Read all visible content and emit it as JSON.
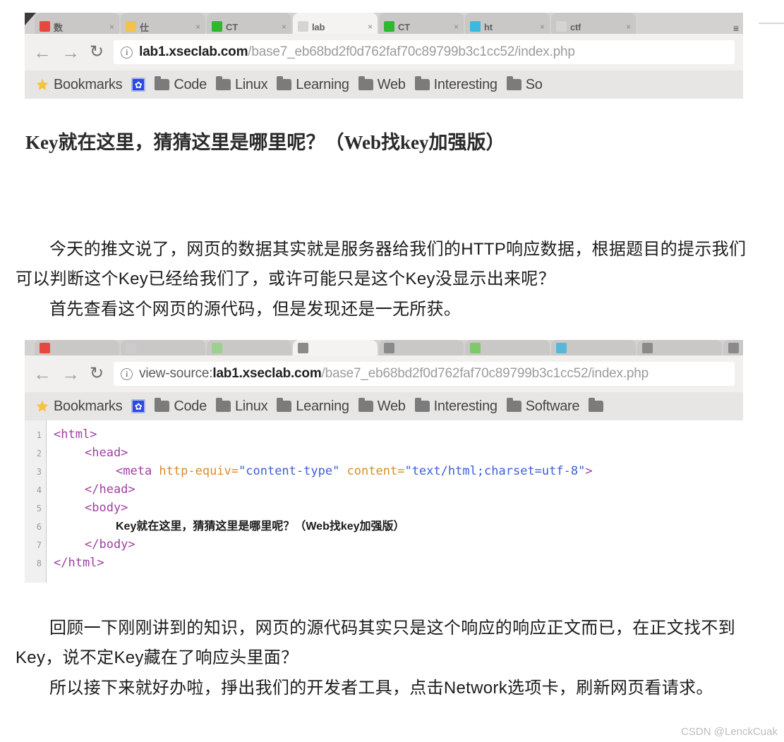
{
  "document": {
    "watermark": "CSDN @LenckCuak"
  },
  "frame": {
    "corner": "container-corner"
  },
  "shot1": {
    "tabs": [
      {
        "title": "数",
        "favicon_color": "#e8473f",
        "close": "×",
        "active": false
      },
      {
        "title": "仕",
        "favicon_color": "#f2c14e",
        "close": "×",
        "active": false
      },
      {
        "title": "CT",
        "favicon_color": "#2eb82e",
        "close": "×",
        "active": false
      },
      {
        "title": "lab",
        "favicon_color": "#d4d4d4",
        "close": "×",
        "active": true
      },
      {
        "title": "CT",
        "favicon_color": "#2eb82e",
        "close": "×",
        "active": false
      },
      {
        "title": "ht",
        "favicon_color": "#3bb9e0",
        "close": "×",
        "active": false
      },
      {
        "title": "ctf",
        "favicon_color": "#d4d4d4",
        "close": "×",
        "active": false
      }
    ],
    "tab_menu_icon": "menu-icon",
    "nav": {
      "back": "←",
      "forward": "→",
      "reload": "↻"
    },
    "omnibox": {
      "security_icon": "info-icon",
      "scheme": "",
      "host": "lab1.xseclab.com",
      "path": "/base7_eb68bd2f0d762faf70c89799b3c1cc52/index.php"
    },
    "bookmarks": [
      {
        "label": "Bookmarks",
        "icon": "star-icon"
      },
      {
        "label": "",
        "icon": "paw-icon"
      },
      {
        "label": "Code",
        "icon": "folder-icon"
      },
      {
        "label": "Linux",
        "icon": "folder-icon"
      },
      {
        "label": "Learning",
        "icon": "folder-icon"
      },
      {
        "label": "Web",
        "icon": "folder-icon"
      },
      {
        "label": "Interesting",
        "icon": "folder-icon"
      },
      {
        "label": "So",
        "icon": "folder-icon"
      }
    ]
  },
  "page_heading": "Key就在这里，猜猜这里是哪里呢？（Web找key加强版）",
  "paragraph1": "今天的推文说了，网页的数据其实就是服务器给我们的HTTP响应数据，根据题目的提示我们可以判断这个Key已经给我们了，或许可能只是这个Key没显示出来呢？",
  "paragraph2": "首先查看这个网页的源代码，但是发现还是一无所获。",
  "shot2": {
    "tabs": [
      {
        "favicon_color": "#e8473f"
      },
      {
        "favicon_color": "#cccccc"
      },
      {
        "favicon_color": "#9ecf8e"
      },
      {
        "favicon_color": "#8a8a8a"
      },
      {
        "favicon_color": "#8a8a8a"
      },
      {
        "favicon_color": "#7fc96b"
      },
      {
        "favicon_color": "#5ab7d8"
      },
      {
        "favicon_color": "#8a8a8a"
      },
      {
        "favicon_color": "#8a8a8a"
      }
    ],
    "nav": {
      "back": "←",
      "forward": "→",
      "reload": "↻"
    },
    "omnibox": {
      "security_icon": "info-icon",
      "scheme": "view-source:",
      "host": "lab1.xseclab.com",
      "path": "/base7_eb68bd2f0d762faf70c89799b3c1cc52/index.php"
    },
    "bookmarks": [
      {
        "label": "Bookmarks",
        "icon": "star-icon"
      },
      {
        "label": "",
        "icon": "paw-icon"
      },
      {
        "label": "Code",
        "icon": "folder-icon"
      },
      {
        "label": "Linux",
        "icon": "folder-icon"
      },
      {
        "label": "Learning",
        "icon": "folder-icon"
      },
      {
        "label": "Web",
        "icon": "folder-icon"
      },
      {
        "label": "Interesting",
        "icon": "folder-icon"
      },
      {
        "label": "Software",
        "icon": "folder-icon"
      },
      {
        "label": "",
        "icon": "folder-icon"
      }
    ],
    "source_lines": [
      {
        "n": "1",
        "indent": 0,
        "parts": [
          {
            "t": "tag",
            "s": "<html>"
          }
        ]
      },
      {
        "n": "2",
        "indent": 4,
        "parts": [
          {
            "t": "tag",
            "s": "<head>"
          }
        ]
      },
      {
        "n": "3",
        "indent": 8,
        "parts": [
          {
            "t": "tag",
            "s": "<meta "
          },
          {
            "t": "attr",
            "s": "http-equiv="
          },
          {
            "t": "val",
            "s": "\"content-type\""
          },
          {
            "t": "tag",
            "s": " "
          },
          {
            "t": "attr",
            "s": "content="
          },
          {
            "t": "val",
            "s": "\"text/html;charset=utf-8\""
          },
          {
            "t": "tag",
            "s": ">"
          }
        ]
      },
      {
        "n": "4",
        "indent": 4,
        "parts": [
          {
            "t": "tag",
            "s": "</head>"
          }
        ]
      },
      {
        "n": "5",
        "indent": 4,
        "parts": [
          {
            "t": "tag",
            "s": "<body>"
          }
        ]
      },
      {
        "n": "6",
        "indent": 8,
        "parts": [
          {
            "t": "plain",
            "s": "Key就在这里，猜猜这里是哪里呢？（Web找key加强版）"
          }
        ]
      },
      {
        "n": "7",
        "indent": 4,
        "parts": [
          {
            "t": "tag",
            "s": "</body>"
          }
        ]
      },
      {
        "n": "8",
        "indent": 0,
        "parts": [
          {
            "t": "tag",
            "s": "</html>"
          }
        ]
      }
    ]
  },
  "paragraph3": "回顾一下刚刚讲到的知识，网页的源代码其实只是这个响应的响应正文而已，在正文找不到Key，说不定Key藏在了响应头里面？",
  "paragraph4": "所以接下来就好办啦，掙出我们的开发者工具，点击Network选项卡，刷新网页看请求。"
}
